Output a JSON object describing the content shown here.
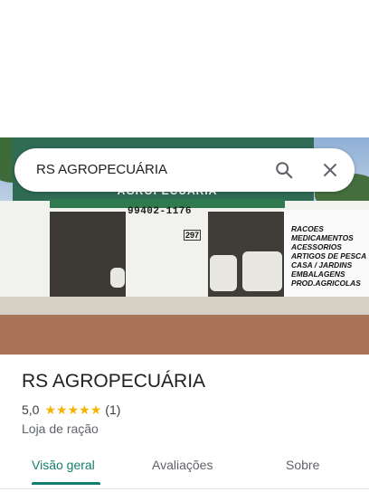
{
  "search": {
    "query": "RS AGROPECUÁRIA",
    "search_icon": "search-icon",
    "clear_icon": "close-icon"
  },
  "photo": {
    "sign_text": "AGROPECUÁRIA",
    "phone_text": "99402-1176",
    "number_plate": "297",
    "services": [
      "RACOES",
      "MEDICAMENTOS",
      "ACESSORIOS",
      "ARTIGOS DE PESCA",
      "CASA / JARDINS",
      "EMBALAGENS",
      "PROD.AGRICOLAS"
    ]
  },
  "place": {
    "name": "RS AGROPECUÁRIA",
    "rating": "5,0",
    "stars": 5,
    "review_count": "(1)",
    "category": "Loja de ração"
  },
  "tabs": [
    {
      "label": "Visão geral",
      "active": true
    },
    {
      "label": "Avaliações",
      "active": false
    },
    {
      "label": "Sobre",
      "active": false
    }
  ],
  "colors": {
    "accent": "#137e6b",
    "star": "#f6b400"
  }
}
